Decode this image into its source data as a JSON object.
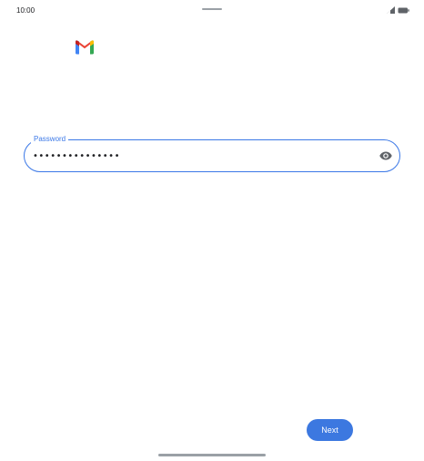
{
  "status_bar": {
    "time": "10:00",
    "icons": [
      "signal-icon",
      "battery-icon"
    ]
  },
  "logo": {
    "icon": "gmail-logo-icon"
  },
  "password_field": {
    "label": "Password",
    "value": "•••••••••••••••",
    "toggle_icon": "eye-icon"
  },
  "actions": {
    "next_label": "Next"
  },
  "colors": {
    "accent": "#3b78e7",
    "button": "#3c78e0",
    "text": "#202124",
    "icon_gray": "#5f6368"
  }
}
